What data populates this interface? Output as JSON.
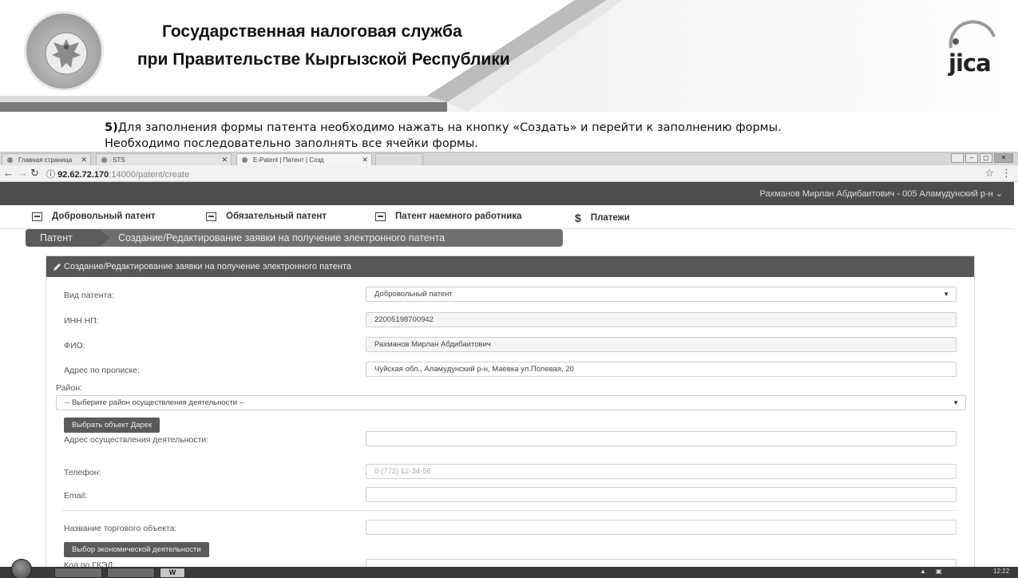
{
  "slide": {
    "org_line1": "Государственная налоговая служба",
    "org_line2": "при Правительстве Кыргызской Республики",
    "logo_text": "jica",
    "instruction_step": "5)",
    "instruction_line1": "Для заполнения формы патента необходимо нажать на кнопку «Создать» и перейти к заполнению формы.",
    "instruction_line2": "Необходимо последовательно заполнять все ячейки формы."
  },
  "browser": {
    "tabs": [
      {
        "label": "Главная страница"
      },
      {
        "label": "STS"
      },
      {
        "label": "E-Patent | Патент | Созд"
      }
    ],
    "url_host": "92.62.72.170",
    "url_path": ":14000/patent/create"
  },
  "app": {
    "user": "Рахманов Мирлан Абдибаитович - 005 Аламудунский р-н",
    "nav": [
      {
        "label": "Добровольный патент"
      },
      {
        "label": "Обязательный патент"
      },
      {
        "label": "Патент наемного работника"
      },
      {
        "label": "Платежи"
      }
    ],
    "breadcrumb": {
      "root": "Патент",
      "current": "Создание/Редактирование заявки на получение электронного патента"
    },
    "panel_title": "Создание/Редактирование заявки на получение электронного патента",
    "form": {
      "patent_type_label": "Вид патента:",
      "patent_type_value": "Добровольный патент",
      "inn_label": "ИНН НП:",
      "inn_value": "22005198700942",
      "fio_label": "ФИО:",
      "fio_value": "Рахманов Мирлан Абдибаитович",
      "address_label": "Адрес по прописке:",
      "address_value": "Чуйская обл., Аламудунский р-н, Маевка ул.Полевая, 20",
      "district_label": "Район:",
      "district_value": "-- Выберите район осуществления деятельности --",
      "select_object_button": "Выбрать объект Дарек",
      "activity_address_label": "Адрес осуществления деятельности:",
      "activity_address_value": "",
      "phone_label": "Телефон:",
      "phone_placeholder": "0 (772) 12-34-56",
      "email_label": "Email:",
      "email_value": "",
      "trade_object_label": "Название торгового объекта:",
      "trade_object_value": "",
      "economic_activity_button": "Выбор экономической деятельности",
      "gked_label": "Код по ГКЭД:"
    }
  },
  "taskbar": {
    "word_icon_label": "W",
    "time": "12:22"
  }
}
